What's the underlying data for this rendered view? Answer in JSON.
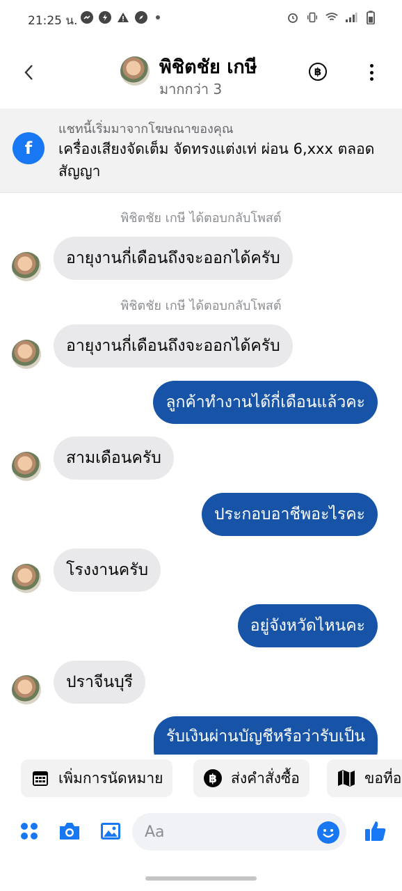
{
  "status_bar": {
    "time": "21:25 น.",
    "left_icons": [
      "messenger-icon",
      "bolt-icon",
      "warning-icon",
      "compass-icon",
      "dot-icon"
    ],
    "right_icons": [
      "alarm-icon",
      "vibrate-icon",
      "wifi-icon",
      "signal-icon",
      "battery-icon"
    ]
  },
  "header": {
    "name": "พิชิตชัย เกษี",
    "subtitle": "มากกว่า 3",
    "baht_symbol": "฿"
  },
  "ad_banner": {
    "caption": "แชทนี้เริ่มมาจากโฆษณาของคุณ",
    "title": "เครื่องเสียงจัดเต็ม จัดทรงแต่งเท่ ผ่อน 6,xxx ตลอดสัญญา",
    "fb_letter": "f"
  },
  "messages": [
    {
      "type": "note",
      "text": "พิชิตชัย เกษี ได้ตอบกลับโพสต์"
    },
    {
      "type": "in",
      "text": "อายุงานกี่เดือนถึงจะออกได้ครับ"
    },
    {
      "type": "note",
      "text": "พิชิตชัย เกษี ได้ตอบกลับโพสต์"
    },
    {
      "type": "in",
      "text": "อายุงานกี่เดือนถึงจะออกได้ครับ"
    },
    {
      "type": "out",
      "text": "ลูกค้าทำงานได้กี่เดือนแล้วคะ"
    },
    {
      "type": "in",
      "text": "สามเดือนครับ"
    },
    {
      "type": "out",
      "text": "ประกอบอาชีพอะไรคะ"
    },
    {
      "type": "in",
      "text": "โรงงานครับ"
    },
    {
      "type": "out",
      "text": "อยู่จังหวัดไหนคะ"
    },
    {
      "type": "in",
      "text": "ปราจีนบุรี"
    },
    {
      "type": "out",
      "text": "รับเงินผ่านบัญชีหรือว่ารับเป็น"
    }
  ],
  "quick_replies": [
    {
      "label": "เพิ่มการนัดหมาย",
      "icon": "calendar-icon"
    },
    {
      "label": "ส่งคำสั่งซื้อ",
      "icon": "baht-icon"
    },
    {
      "label": "ขอที่อ",
      "icon": "map-icon"
    }
  ],
  "composer": {
    "placeholder": "Aa",
    "icons": [
      "menu-dots-icon",
      "camera-icon",
      "image-icon",
      "emoji-icon",
      "like-icon"
    ]
  },
  "colors": {
    "outgoing_bubble": "#1754a8",
    "incoming_bubble": "#e9e9eb",
    "accent": "#1877f2"
  }
}
